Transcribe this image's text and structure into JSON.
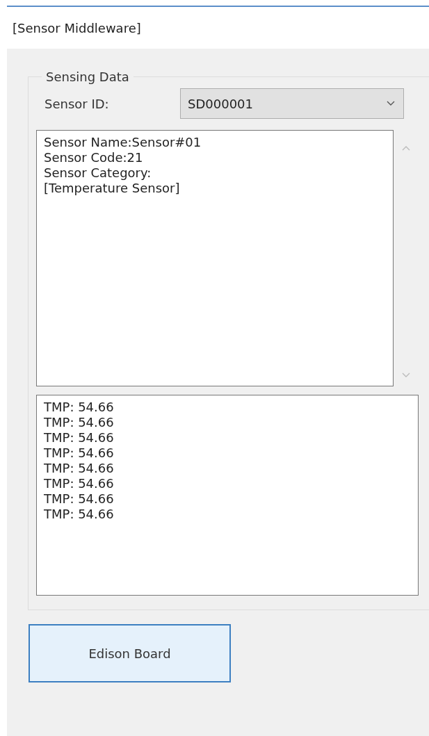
{
  "window": {
    "title": "[Sensor Middleware]"
  },
  "group": {
    "title": "Sensing Data",
    "sensor_id": {
      "label": "Sensor ID:",
      "value": "SD000001"
    },
    "info_lines": [
      "Sensor Name:Sensor#01",
      "Sensor Code:21",
      "Sensor Category:",
      "[Temperature Sensor]"
    ],
    "readings": [
      "TMP: 54.66",
      "TMP: 54.66",
      "TMP: 54.66",
      "TMP: 54.66",
      "TMP: 54.66",
      "TMP: 54.66",
      "TMP: 54.66",
      "TMP: 54.66"
    ]
  },
  "buttons": [
    {
      "label": "Edison Board"
    }
  ]
}
